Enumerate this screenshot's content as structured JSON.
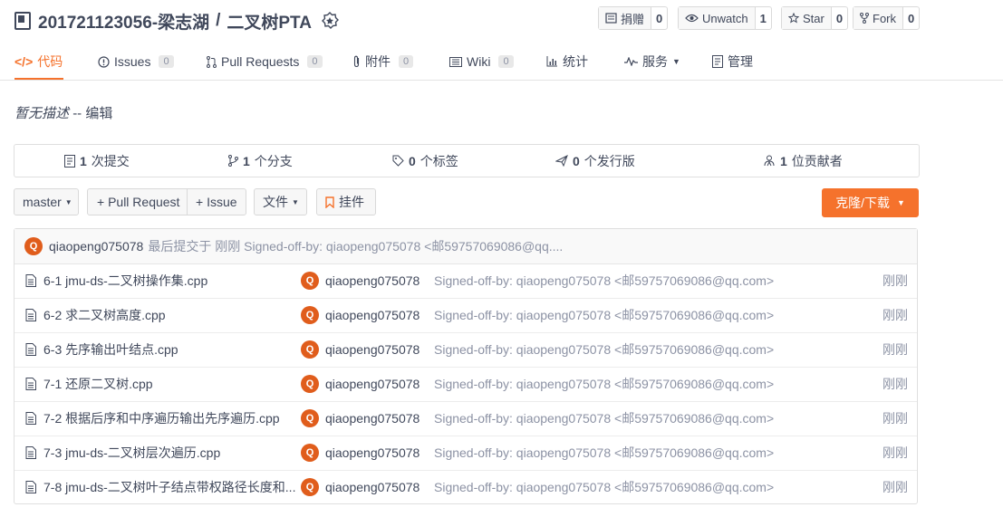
{
  "repo": {
    "owner": "201721123056-梁志湖",
    "name": "二叉树PTA"
  },
  "header_buttons": [
    {
      "label": "捐赠",
      "count": "0",
      "icon": "donate-icon"
    },
    {
      "label": "Unwatch",
      "count": "1",
      "icon": "eye-icon"
    },
    {
      "label": "Star",
      "count": "0",
      "icon": "star-icon"
    },
    {
      "label": "Fork",
      "count": "0",
      "icon": "fork-icon"
    }
  ],
  "tabs": [
    {
      "label": "代码",
      "icon": "code-icon",
      "active": true
    },
    {
      "label": "Issues",
      "count": "0",
      "icon": "issue-icon"
    },
    {
      "label": "Pull Requests",
      "count": "0",
      "icon": "pull-request-icon"
    },
    {
      "label": "附件",
      "count": "0",
      "icon": "attachment-icon"
    },
    {
      "label": "Wiki",
      "count": "0",
      "icon": "wiki-icon"
    },
    {
      "label": "统计",
      "icon": "stats-icon"
    },
    {
      "label": "服务",
      "icon": "service-icon"
    },
    {
      "label": "管理",
      "icon": "manage-icon"
    }
  ],
  "description": {
    "text": "暂无描述",
    "sep": "--",
    "edit": "编辑"
  },
  "stats": [
    {
      "count": "1",
      "label": "次提交",
      "icon": "commit-icon"
    },
    {
      "count": "1",
      "label": "个分支",
      "icon": "branch-icon"
    },
    {
      "count": "0",
      "label": "个标签",
      "icon": "tag-icon"
    },
    {
      "count": "0",
      "label": "个发行版",
      "icon": "release-icon"
    },
    {
      "count": "1",
      "label": "位贡献者",
      "icon": "contributors-icon"
    }
  ],
  "actions": {
    "branch": "master",
    "pull_request": "+ Pull Request",
    "issue": "+ Issue",
    "files": "文件",
    "widget": "挂件",
    "clone": "克隆/下载"
  },
  "last_commit": {
    "avatar": "Q",
    "author": "qiaopeng075078",
    "text": "最后提交于 刚刚 Signed-off-by: qiaopeng075078 <邮59757069086@qq...."
  },
  "files": [
    {
      "name": "6-1 jmu-ds-二叉树操作集.cpp",
      "author": "qiaopeng075078",
      "message": "Signed-off-by: qiaopeng075078 <邮59757069086@qq.com>",
      "time": "刚刚"
    },
    {
      "name": "6-2 求二叉树高度.cpp",
      "author": "qiaopeng075078",
      "message": "Signed-off-by: qiaopeng075078 <邮59757069086@qq.com>",
      "time": "刚刚"
    },
    {
      "name": "6-3 先序输出叶结点.cpp",
      "author": "qiaopeng075078",
      "message": "Signed-off-by: qiaopeng075078 <邮59757069086@qq.com>",
      "time": "刚刚"
    },
    {
      "name": "7-1 还原二叉树.cpp",
      "author": "qiaopeng075078",
      "message": "Signed-off-by: qiaopeng075078 <邮59757069086@qq.com>",
      "time": "刚刚"
    },
    {
      "name": "7-2 根据后序和中序遍历输出先序遍历.cpp",
      "author": "qiaopeng075078",
      "message": "Signed-off-by: qiaopeng075078 <邮59757069086@qq.com>",
      "time": "刚刚"
    },
    {
      "name": "7-3 jmu-ds-二叉树层次遍历.cpp",
      "author": "qiaopeng075078",
      "message": "Signed-off-by: qiaopeng075078 <邮59757069086@qq.com>",
      "time": "刚刚"
    },
    {
      "name": "7-8 jmu-ds-二叉树叶子结点带权路径长度和...",
      "author": "qiaopeng075078",
      "message": "Signed-off-by: qiaopeng075078 <邮59757069086@qq.com>",
      "time": "刚刚"
    }
  ],
  "colors": {
    "accent": "#f5722c",
    "avatar": "#e05d1c"
  }
}
